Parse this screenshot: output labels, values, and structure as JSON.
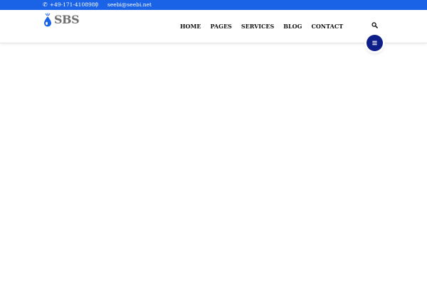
{
  "topbar": {
    "phone_icon": "phone-icon",
    "phone": "+49-171-4108980",
    "email": "seebi@seebi.net",
    "background": "#1b63e6"
  },
  "header": {
    "logo_text": "SBS",
    "logo_icon": "water-drop-logo-icon",
    "nav": [
      "HOME",
      "PAGES",
      "SERVICES",
      "BLOG",
      "CONTACT"
    ],
    "search_icon": "search-icon",
    "menu_icon": "hamburger-menu-icon",
    "menu_button_color": "#0f1f8a"
  }
}
